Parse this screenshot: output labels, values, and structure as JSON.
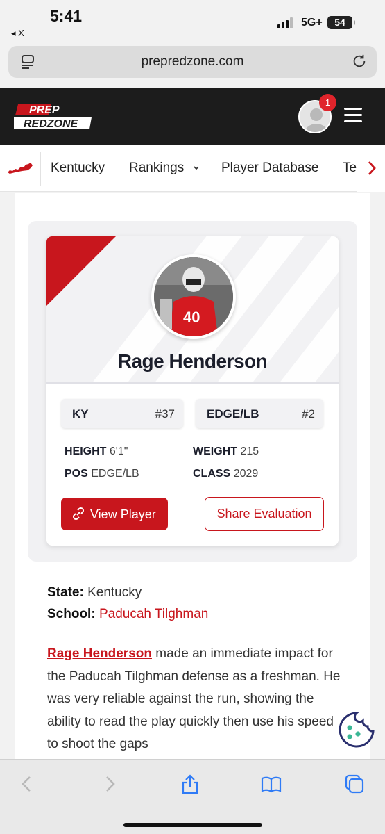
{
  "status_bar": {
    "time": "5:41",
    "back_label": "◂ X",
    "network": "5G+",
    "battery": "54"
  },
  "browser": {
    "url": "prepredzone.com"
  },
  "header": {
    "logo_line1": "PREP",
    "logo_line2": "REDZONE",
    "notification_count": "1"
  },
  "nav": {
    "items": [
      "Kentucky",
      "Rankings",
      "Player Database",
      "Te"
    ]
  },
  "player": {
    "name": "Rage Henderson",
    "jersey_number": "40",
    "state_rank": {
      "label": "KY",
      "value": "#37"
    },
    "position_rank": {
      "label": "EDGE/LB",
      "value": "#2"
    },
    "height": {
      "label": "HEIGHT",
      "value": "6'1\""
    },
    "weight": {
      "label": "WEIGHT",
      "value": "215"
    },
    "pos": {
      "label": "POS",
      "value": "EDGE/LB"
    },
    "class": {
      "label": "CLASS",
      "value": "2029"
    },
    "view_button": "View Player",
    "share_button": "Share Evaluation"
  },
  "details": {
    "state_label": "State:",
    "state_value": "Kentucky",
    "school_label": "School:",
    "school_value": "Paducah Tilghman"
  },
  "bio": {
    "name_link": "Rage Henderson",
    "text": " made an immediate impact for the Paducah Tilghman defense as a freshman. He was very reliable against the run, showing the ability to read the play quickly then use his speed to shoot the gaps"
  },
  "colors": {
    "brand_red": "#c8161d",
    "header_bg": "#1c1c1c",
    "ios_blue": "#2f7bf6"
  },
  "icons": [
    "reader-icon",
    "reload-icon",
    "avatar-icon",
    "menu-icon",
    "kentucky-icon",
    "chevron-down-icon",
    "chevron-right-icon",
    "link-icon",
    "cookie-icon",
    "back-icon",
    "forward-icon",
    "share-icon",
    "bookmarks-icon",
    "tabs-icon"
  ]
}
